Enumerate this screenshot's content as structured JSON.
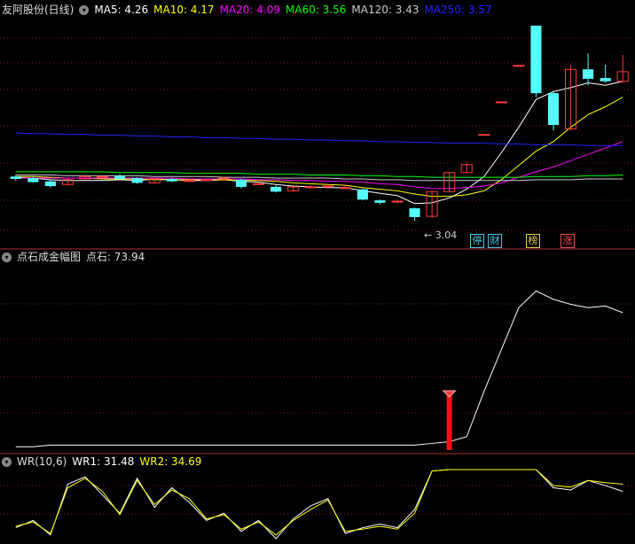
{
  "main_panel": {
    "title": "友阿股份(日线)",
    "indicators": [
      {
        "label": "MA5: 4.26",
        "color": "#ffffff"
      },
      {
        "label": "MA10: 4.17",
        "color": "#ffff00"
      },
      {
        "label": "MA20: 4.09",
        "color": "#ff00ff"
      },
      {
        "label": "MA60: 3.56",
        "color": "#00ff00"
      },
      {
        "label": "MA120: 3.43",
        "color": "#cccccc"
      },
      {
        "label": "MA250: 3.57",
        "color": "#2222ff"
      }
    ],
    "low_label": "3.04",
    "tags": [
      {
        "text": "停",
        "color": "#4fc8e8"
      },
      {
        "text": "财",
        "color": "#4fc8e8"
      },
      {
        "text": "榜",
        "color": "#e8c84f"
      },
      {
        "text": "涨",
        "color": "#e84f4f"
      }
    ]
  },
  "mid_panel": {
    "title": "点石成金幅图",
    "value_label": "点石: 73.94"
  },
  "wr_panel": {
    "title": "WR(10,6)",
    "wr1": "WR1: 31.48",
    "wr2": "WR2: 34.69"
  },
  "chart_data": {
    "type": "candlestick",
    "candles": [
      {
        "o": 3.6,
        "c": 3.57,
        "h": 3.62,
        "l": 3.55
      },
      {
        "o": 3.58,
        "c": 3.53,
        "h": 3.6,
        "l": 3.52
      },
      {
        "o": 3.54,
        "c": 3.48,
        "h": 3.56,
        "l": 3.46
      },
      {
        "o": 3.5,
        "c": 3.56,
        "h": 3.58,
        "l": 3.49
      },
      {
        "o": 3.57,
        "c": 3.6,
        "h": 3.62,
        "l": 3.56
      },
      {
        "o": 3.6,
        "c": 3.6,
        "h": 3.62,
        "l": 3.58
      },
      {
        "o": 3.61,
        "c": 3.57,
        "h": 3.63,
        "l": 3.56
      },
      {
        "o": 3.58,
        "c": 3.52,
        "h": 3.59,
        "l": 3.51
      },
      {
        "o": 3.52,
        "c": 3.57,
        "h": 3.58,
        "l": 3.51
      },
      {
        "o": 3.57,
        "c": 3.54,
        "h": 3.58,
        "l": 3.53
      },
      {
        "o": 3.54,
        "c": 3.55,
        "h": 3.57,
        "l": 3.53
      },
      {
        "o": 3.56,
        "c": 3.56,
        "h": 3.58,
        "l": 3.55
      },
      {
        "o": 3.57,
        "c": 3.58,
        "h": 3.6,
        "l": 3.56
      },
      {
        "o": 3.56,
        "c": 3.47,
        "h": 3.57,
        "l": 3.45
      },
      {
        "o": 3.51,
        "c": 3.51,
        "h": 3.53,
        "l": 3.49
      },
      {
        "o": 3.47,
        "c": 3.41,
        "h": 3.49,
        "l": 3.4
      },
      {
        "o": 3.42,
        "c": 3.47,
        "h": 3.49,
        "l": 3.41
      },
      {
        "o": 3.47,
        "c": 3.47,
        "h": 3.49,
        "l": 3.45
      },
      {
        "o": 3.47,
        "c": 3.48,
        "h": 3.5,
        "l": 3.46
      },
      {
        "o": 3.46,
        "c": 3.46,
        "h": 3.5,
        "l": 3.44
      },
      {
        "o": 3.44,
        "c": 3.31,
        "h": 3.45,
        "l": 3.3
      },
      {
        "o": 3.3,
        "c": 3.27,
        "h": 3.31,
        "l": 3.25
      },
      {
        "o": 3.28,
        "c": 3.29,
        "h": 3.31,
        "l": 3.26
      },
      {
        "o": 3.2,
        "c": 3.09,
        "h": 3.21,
        "l": 3.04
      },
      {
        "o": 3.1,
        "c": 3.41,
        "h": 3.42,
        "l": 3.08
      },
      {
        "o": 3.41,
        "c": 3.65,
        "h": 3.66,
        "l": 3.4
      },
      {
        "o": 3.65,
        "c": 3.75,
        "h": 3.77,
        "l": 3.64
      },
      {
        "o": 4.13,
        "c": 4.13,
        "h": 4.13,
        "l": 4.13
      },
      {
        "o": 4.54,
        "c": 4.54,
        "h": 4.54,
        "l": 4.54
      },
      {
        "o": 5.0,
        "c": 5.0,
        "h": 5.0,
        "l": 5.0
      },
      {
        "o": 5.5,
        "c": 4.65,
        "h": 5.5,
        "l": 4.6
      },
      {
        "o": 4.65,
        "c": 4.25,
        "h": 4.68,
        "l": 4.18
      },
      {
        "o": 4.2,
        "c": 4.95,
        "h": 5.0,
        "l": 4.18
      },
      {
        "o": 4.95,
        "c": 4.83,
        "h": 5.15,
        "l": 4.75
      },
      {
        "o": 4.84,
        "c": 4.8,
        "h": 5.01,
        "l": 4.78
      },
      {
        "o": 4.8,
        "c": 4.92,
        "h": 5.13,
        "l": 4.78
      }
    ],
    "ma_lines": [
      {
        "name": "MA5",
        "color": "#ffffff",
        "values": [
          3.59,
          3.58,
          3.56,
          3.55,
          3.55,
          3.55,
          3.56,
          3.55,
          3.57,
          3.56,
          3.55,
          3.55,
          3.56,
          3.54,
          3.53,
          3.5,
          3.48,
          3.47,
          3.46,
          3.46,
          3.42,
          3.39,
          3.36,
          3.26,
          3.27,
          3.33,
          3.44,
          3.6,
          3.9,
          4.22,
          4.57,
          4.67,
          4.72,
          4.78,
          4.75,
          4.8
        ]
      },
      {
        "name": "MA10",
        "color": "#ffff00",
        "values": [
          3.6,
          3.6,
          3.59,
          3.58,
          3.58,
          3.57,
          3.57,
          3.57,
          3.56,
          3.56,
          3.56,
          3.56,
          3.56,
          3.55,
          3.55,
          3.54,
          3.52,
          3.51,
          3.5,
          3.49,
          3.46,
          3.44,
          3.42,
          3.38,
          3.35,
          3.35,
          3.37,
          3.42,
          3.56,
          3.74,
          3.92,
          4.04,
          4.22,
          4.38,
          4.48,
          4.6
        ]
      },
      {
        "name": "MA20",
        "color": "#ff00ff",
        "values": [
          3.58,
          3.58,
          3.58,
          3.58,
          3.58,
          3.58,
          3.58,
          3.58,
          3.58,
          3.58,
          3.57,
          3.57,
          3.57,
          3.57,
          3.56,
          3.56,
          3.55,
          3.55,
          3.54,
          3.54,
          3.53,
          3.51,
          3.5,
          3.47,
          3.45,
          3.45,
          3.46,
          3.48,
          3.52,
          3.59,
          3.66,
          3.72,
          3.8,
          3.88,
          3.96,
          4.04
        ]
      },
      {
        "name": "MA60",
        "color": "#00ff00",
        "values": [
          3.66,
          3.66,
          3.66,
          3.66,
          3.66,
          3.66,
          3.65,
          3.65,
          3.65,
          3.65,
          3.64,
          3.64,
          3.64,
          3.64,
          3.63,
          3.63,
          3.63,
          3.62,
          3.62,
          3.62,
          3.61,
          3.61,
          3.6,
          3.6,
          3.59,
          3.59,
          3.59,
          3.59,
          3.59,
          3.59,
          3.6,
          3.6,
          3.6,
          3.61,
          3.61,
          3.62
        ]
      },
      {
        "name": "MA120",
        "color": "#cccccc",
        "values": [
          3.62,
          3.62,
          3.62,
          3.61,
          3.61,
          3.61,
          3.61,
          3.61,
          3.6,
          3.6,
          3.6,
          3.6,
          3.59,
          3.59,
          3.59,
          3.58,
          3.58,
          3.58,
          3.58,
          3.57,
          3.57,
          3.56,
          3.56,
          3.55,
          3.55,
          3.55,
          3.55,
          3.55,
          3.55,
          3.55,
          3.56,
          3.56,
          3.56,
          3.57,
          3.57,
          3.57
        ]
      },
      {
        "name": "MA250",
        "color": "#2222ff",
        "values": [
          4.15,
          4.14,
          4.14,
          4.13,
          4.13,
          4.12,
          4.12,
          4.11,
          4.11,
          4.1,
          4.1,
          4.09,
          4.09,
          4.08,
          4.08,
          4.07,
          4.07,
          4.06,
          4.06,
          4.05,
          4.05,
          4.04,
          4.04,
          4.03,
          4.03,
          4.02,
          4.02,
          4.02,
          4.01,
          4.01,
          4.0,
          4.0,
          4.0,
          3.99,
          3.99,
          3.99
        ]
      }
    ],
    "ylim_main": [
      2.9,
      5.6
    ],
    "dianshi": [
      2,
      2,
      3,
      3,
      3,
      3,
      3,
      3,
      3,
      3,
      3,
      3,
      3,
      3,
      3,
      3,
      3,
      3,
      3,
      3,
      3,
      3,
      3,
      3,
      4,
      5,
      8,
      35,
      60,
      85,
      95,
      90,
      87,
      85,
      86,
      82
    ],
    "dianshi_ylim": [
      0,
      110
    ],
    "signal_index": 25,
    "wr1": [
      80,
      70,
      90,
      20,
      10,
      35,
      60,
      12,
      52,
      25,
      45,
      70,
      60,
      85,
      70,
      95,
      68,
      50,
      40,
      88,
      80,
      75,
      80,
      55,
      2,
      0,
      0,
      0,
      0,
      0,
      0,
      25,
      28,
      15,
      22,
      30
    ],
    "wr2": [
      78,
      72,
      88,
      25,
      12,
      30,
      62,
      15,
      48,
      28,
      40,
      68,
      62,
      82,
      72,
      90,
      70,
      55,
      42,
      85,
      82,
      78,
      82,
      60,
      2,
      0,
      0,
      0,
      0,
      0,
      0,
      22,
      24,
      15,
      18,
      20
    ]
  }
}
